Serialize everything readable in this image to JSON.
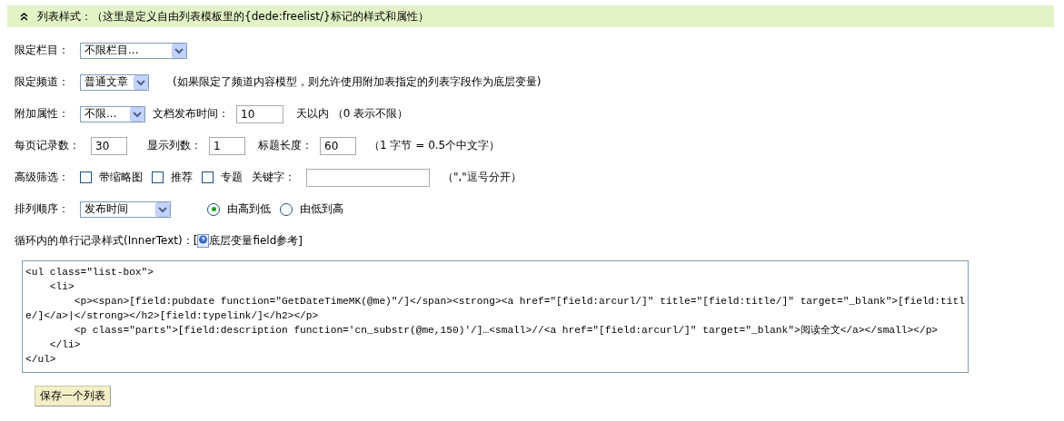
{
  "header": {
    "title": "列表样式：（这里是定义自由列表模板里的{dede:freelist/}标记的样式和属性）",
    "expanded": true
  },
  "category": {
    "label": "限定栏目：",
    "value": "不限栏目..."
  },
  "channel": {
    "label": "限定频道：",
    "value": "普通文章",
    "note": "(如果限定了频道内容模型，则允许使用附加表指定的列表字段作为底层变量)"
  },
  "attributes": {
    "label": "附加属性：",
    "value": "不限...",
    "time_label": "文档发布时间：",
    "time_value": "10",
    "time_note": "天以内 （0 表示不限）"
  },
  "paging": {
    "label": "每页记录数：",
    "value": "30",
    "columns_label": "显示列数：",
    "columns_value": "1",
    "title_label": "标题长度：",
    "title_value": "60",
    "note": "（1 字节 = 0.5个中文字）"
  },
  "filters": {
    "label": "高级筛选：",
    "options": [
      {
        "label": "带缩略图",
        "checked": false
      },
      {
        "label": "推荐",
        "checked": false
      },
      {
        "label": "专题",
        "checked": false
      }
    ],
    "keyword_label": "关键字：",
    "keyword_note": "（\",\"逗号分开）"
  },
  "sort": {
    "label": "排列顺序：",
    "value": "发布时间",
    "orders": [
      {
        "label": "由高到低",
        "selected": true
      },
      {
        "label": "由低到高",
        "selected": false
      }
    ]
  },
  "inner_text": {
    "label": "循环内的单行记录样式(InnerText)：[",
    "link": "底层变量field参考",
    "close": "]"
  },
  "template": {
    "value": "<ul class=\"list-box\">\n    <li>\n        <p><span>[field:pubdate function=\"GetDateTimeMK(@me)\"/]</span><strong><a href=\"[field:arcurl/]\" title=\"[field:title/]\" target=\"_blank\">[field:title/]</a>|</strong></h2>[field:typelink/]</h2></p>\n        <p class=\"parts\">[field:description function='cn_substr(@me,150)'/]…<small>//<a href=\"[field:arcurl/]\" target=\"_blank\">阅读全文</a></small></p>\n    </li>\n</ul>"
  },
  "save_button": "保存一个列表"
}
